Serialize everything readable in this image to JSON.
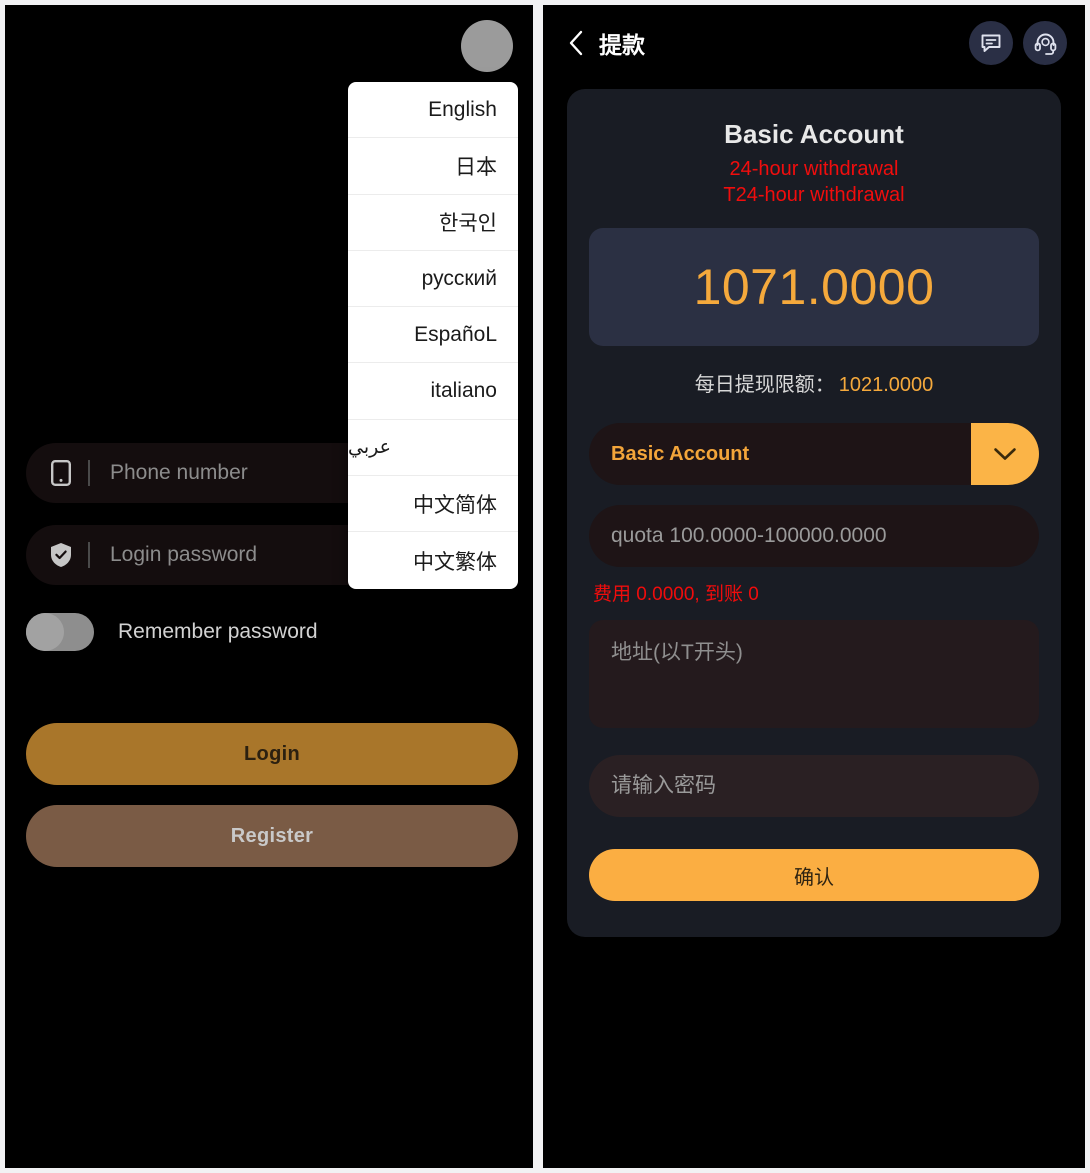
{
  "login_panel": {
    "avatar": "user-avatar",
    "language_menu": {
      "items": [
        {
          "label": "English"
        },
        {
          "label": "日本"
        },
        {
          "label": "한국인"
        },
        {
          "label": "русский"
        },
        {
          "label": "EspañoL"
        },
        {
          "label": "italiano"
        },
        {
          "label": "عربي"
        },
        {
          "label": "中文简体"
        },
        {
          "label": "中文繁体"
        }
      ]
    },
    "phone_field": {
      "placeholder": "Phone number",
      "value": "",
      "icon": "phone-icon"
    },
    "password_field": {
      "placeholder": "Login password",
      "value": "",
      "icon": "shield-check-icon"
    },
    "remember": {
      "label": "Remember password",
      "state": "off"
    },
    "login_button": "Login",
    "register_button": "Register",
    "colors": {
      "login_bg": "#A9762A",
      "register_bg": "#7A5B45",
      "field_bg": "#140D0E"
    }
  },
  "withdraw_panel": {
    "topbar": {
      "back_icon": "chevron-left-icon",
      "title": "提款",
      "message_icon": "message-icon",
      "support_icon": "customer-service-icon"
    },
    "account": {
      "title": "Basic Account",
      "note_line1": "24-hour withdrawal",
      "note_line2": "T24-hour withdrawal",
      "note_color": "#F10D0D"
    },
    "balance": {
      "value": "1071.0000",
      "color": "#F5A93C"
    },
    "daily_limit": {
      "label": "每日提现限额：",
      "value": "1021.0000"
    },
    "account_select": {
      "value": "Basic Account",
      "arrow_icon": "chevron-down-icon"
    },
    "amount_field": {
      "placeholder": "quota 100.0000-100000.0000",
      "value": ""
    },
    "fee_note": "费用 0.0000, 到账 0",
    "address_field": {
      "placeholder": "地址(以T开头)",
      "value": ""
    },
    "password_field": {
      "placeholder": "请输入密码",
      "value": ""
    },
    "confirm_button": "确认",
    "colors": {
      "accent": "#FBAE42",
      "card_bg": "#191C24",
      "balance_bg": "#2B3043"
    }
  }
}
